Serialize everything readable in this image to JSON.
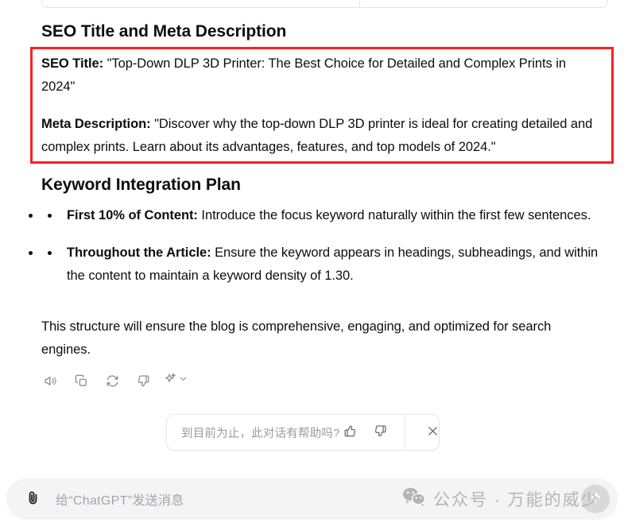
{
  "window": {
    "background_color": "#ffffff",
    "text_color": "#0d0d0d"
  },
  "table_remnant": {
    "description": "partially visible bottom edge of a two-column table"
  },
  "message": {
    "headings": {
      "seo": "SEO Title and Meta Description",
      "keyword": "Keyword Integration Plan"
    },
    "seo_block": {
      "highlight_color": "#fb2020",
      "seo_title_label": "SEO Title:",
      "seo_title_value": " \"Top-Down DLP 3D Printer: The Best Choice for Detailed and Complex Prints in 2024\"",
      "meta_desc_label": "Meta Description:",
      "meta_desc_value": " \"Discover why the top-down DLP 3D printer is ideal for creating detailed and complex prints. Learn about its advantages, features, and top models of 2024.\""
    },
    "bullets": [
      {
        "label": "First 10% of Content:",
        "text": " Introduce the focus keyword naturally within the first few sentences."
      },
      {
        "label": "Throughout the Article:",
        "text": " Ensure the keyword appears in headings, subheadings, and within the content to maintain a keyword density of 1.30."
      }
    ],
    "closing": "This structure will ensure the blog is comprehensive, engaging, and optimized for search engines."
  },
  "actions": {
    "read_aloud": "read-aloud",
    "copy": "copy",
    "regenerate": "regenerate",
    "dislike": "bad-response",
    "switch_model": "switch-model"
  },
  "feedback": {
    "question": "到目前为止，此对话有帮助吗?",
    "thumbs_up": "thumbs-up",
    "thumbs_down": "thumbs-down",
    "close": "×"
  },
  "composer": {
    "attach": "attach-file",
    "placeholder": "给“ChatGPT”发送消息",
    "send": "send-message"
  },
  "watermark": {
    "text": "公众号 · 万能的威少",
    "color": "#b4b4b4",
    "logo": "wechat-logo"
  }
}
